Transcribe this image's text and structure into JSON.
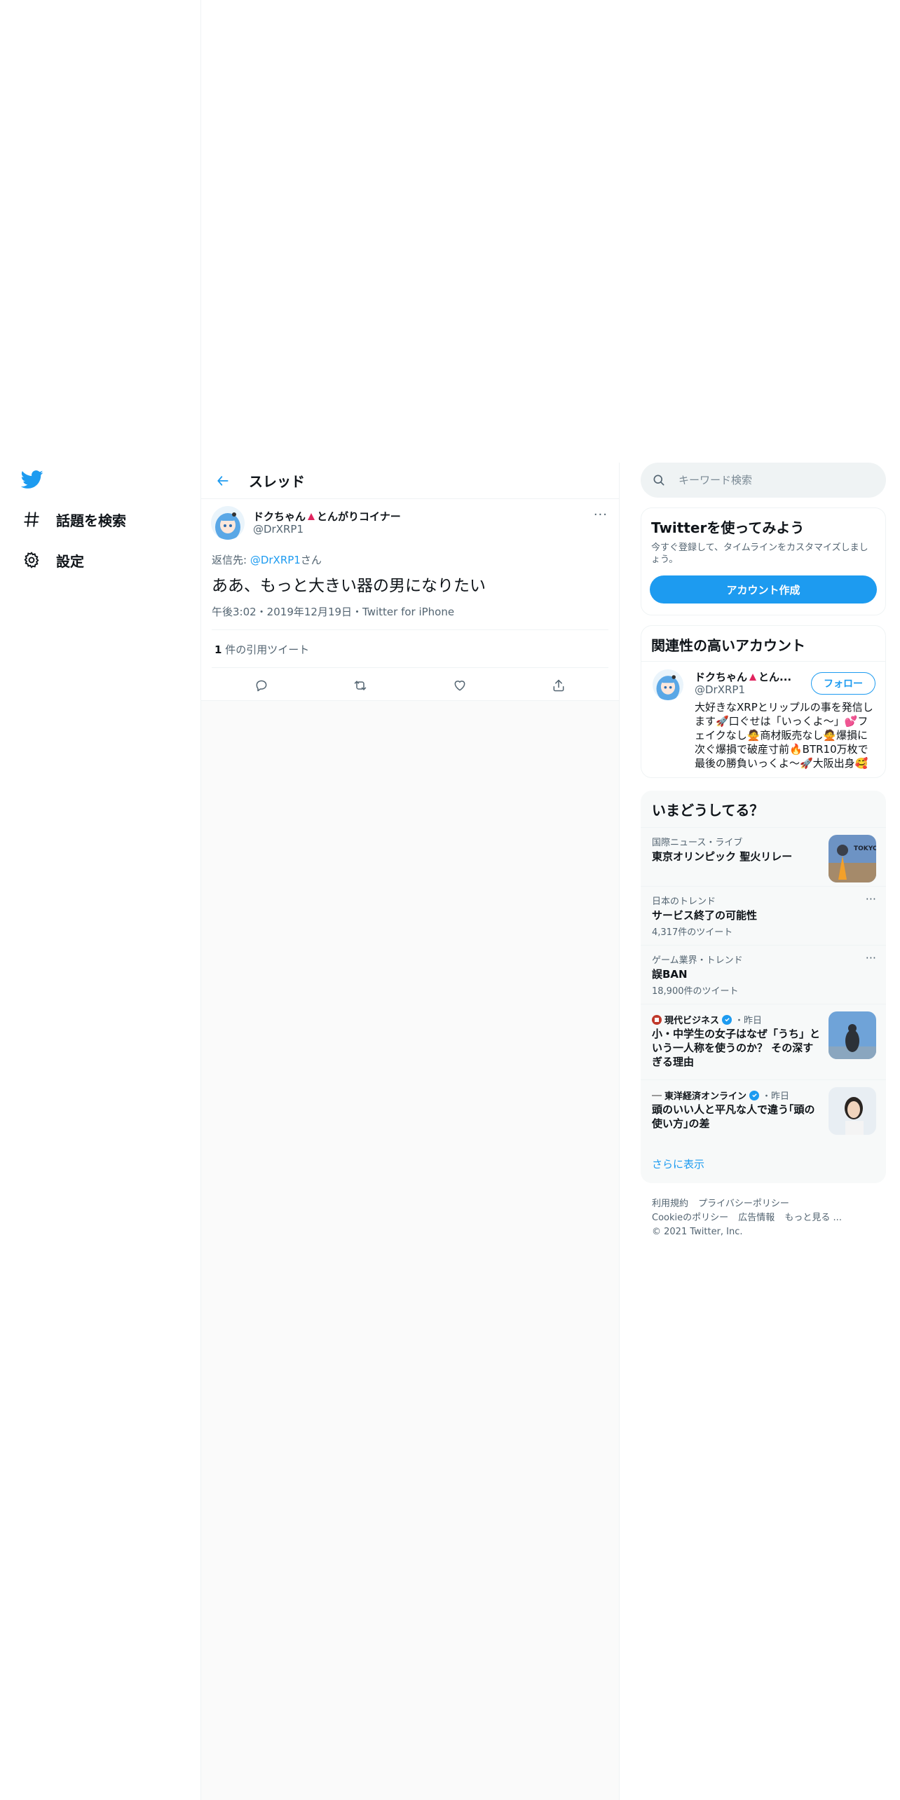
{
  "colors": {
    "accent": "#1d9bf0",
    "text": "#0f1419",
    "muted": "#536471",
    "border": "#eff3f4"
  },
  "nav": {
    "logo_icon": "twitter-bird-icon",
    "items": [
      {
        "icon": "hashtag-icon",
        "label": "話題を検索"
      },
      {
        "icon": "gear-icon",
        "label": "設定"
      }
    ]
  },
  "thread": {
    "title": "スレッド"
  },
  "tweet": {
    "author_name": "ドクちゃん",
    "author_name_suffix": "とんがりコイナー",
    "author_handle": "@DrXRP1",
    "more_label": "···",
    "reply_to_prefix": "返信先: ",
    "reply_to_handle": "@DrXRP1",
    "reply_to_suffix": "さん",
    "text": "ああ、もっと大きい器の男になりたい",
    "meta": "午後3:02・2019年12月19日・Twitter for iPhone",
    "quote_count": "1",
    "quote_label": " 件の引用ツイート"
  },
  "search": {
    "placeholder": "キーワード検索"
  },
  "signup": {
    "title": "Twitterを使ってみよう",
    "description": "今すぐ登録して、タイムラインをカスタマイズしましょう。",
    "button_label": "アカウント作成"
  },
  "related": {
    "title": "関連性の高いアカウント",
    "name": "ドクちゃん",
    "name_suffix": "とん...",
    "handle": "@DrXRP1",
    "follow_label": "フォロー",
    "bio": "大好きなXRPとリップルの事を発信します🚀口ぐせは「いっくよ〜」💕フェイクなし🙅商材販売なし🙅爆損に次ぐ爆損で破産寸前🔥BTR10万枚で最後の勝負いっくよ〜🚀大阪出身🥰"
  },
  "trends": {
    "title": "いまどうしてる？",
    "items": [
      {
        "category": "国際ニュース・ライブ",
        "name": "東京オリンピック 聖火リレー",
        "count": ""
      },
      {
        "category": "日本のトレンド",
        "name": "サービス終了の可能性",
        "count": "4,317件のツイート"
      },
      {
        "category": "ゲーム業界・トレンド",
        "name": "誤BAN",
        "count": "18,900件のツイート"
      }
    ],
    "news": [
      {
        "source": "現代ビジネス",
        "time": "・昨日",
        "headline": "小・中学生の女子はなぜ「うち」という一人称を使うのか？ その深すぎる理由"
      },
      {
        "source": "東洋経済オンライン",
        "time": "・昨日",
        "headline": "頭のいい人と平凡な人で違う｢頭の使い方｣の差"
      }
    ],
    "thumb_text": "TOKYO",
    "more_label": "さらに表示"
  },
  "footer": {
    "links_row1": [
      "利用規約",
      "プライバシーポリシー"
    ],
    "links_row2": [
      "Cookieのポリシー",
      "広告情報",
      "もっと見る ..."
    ],
    "copyright": "© 2021 Twitter, Inc."
  }
}
